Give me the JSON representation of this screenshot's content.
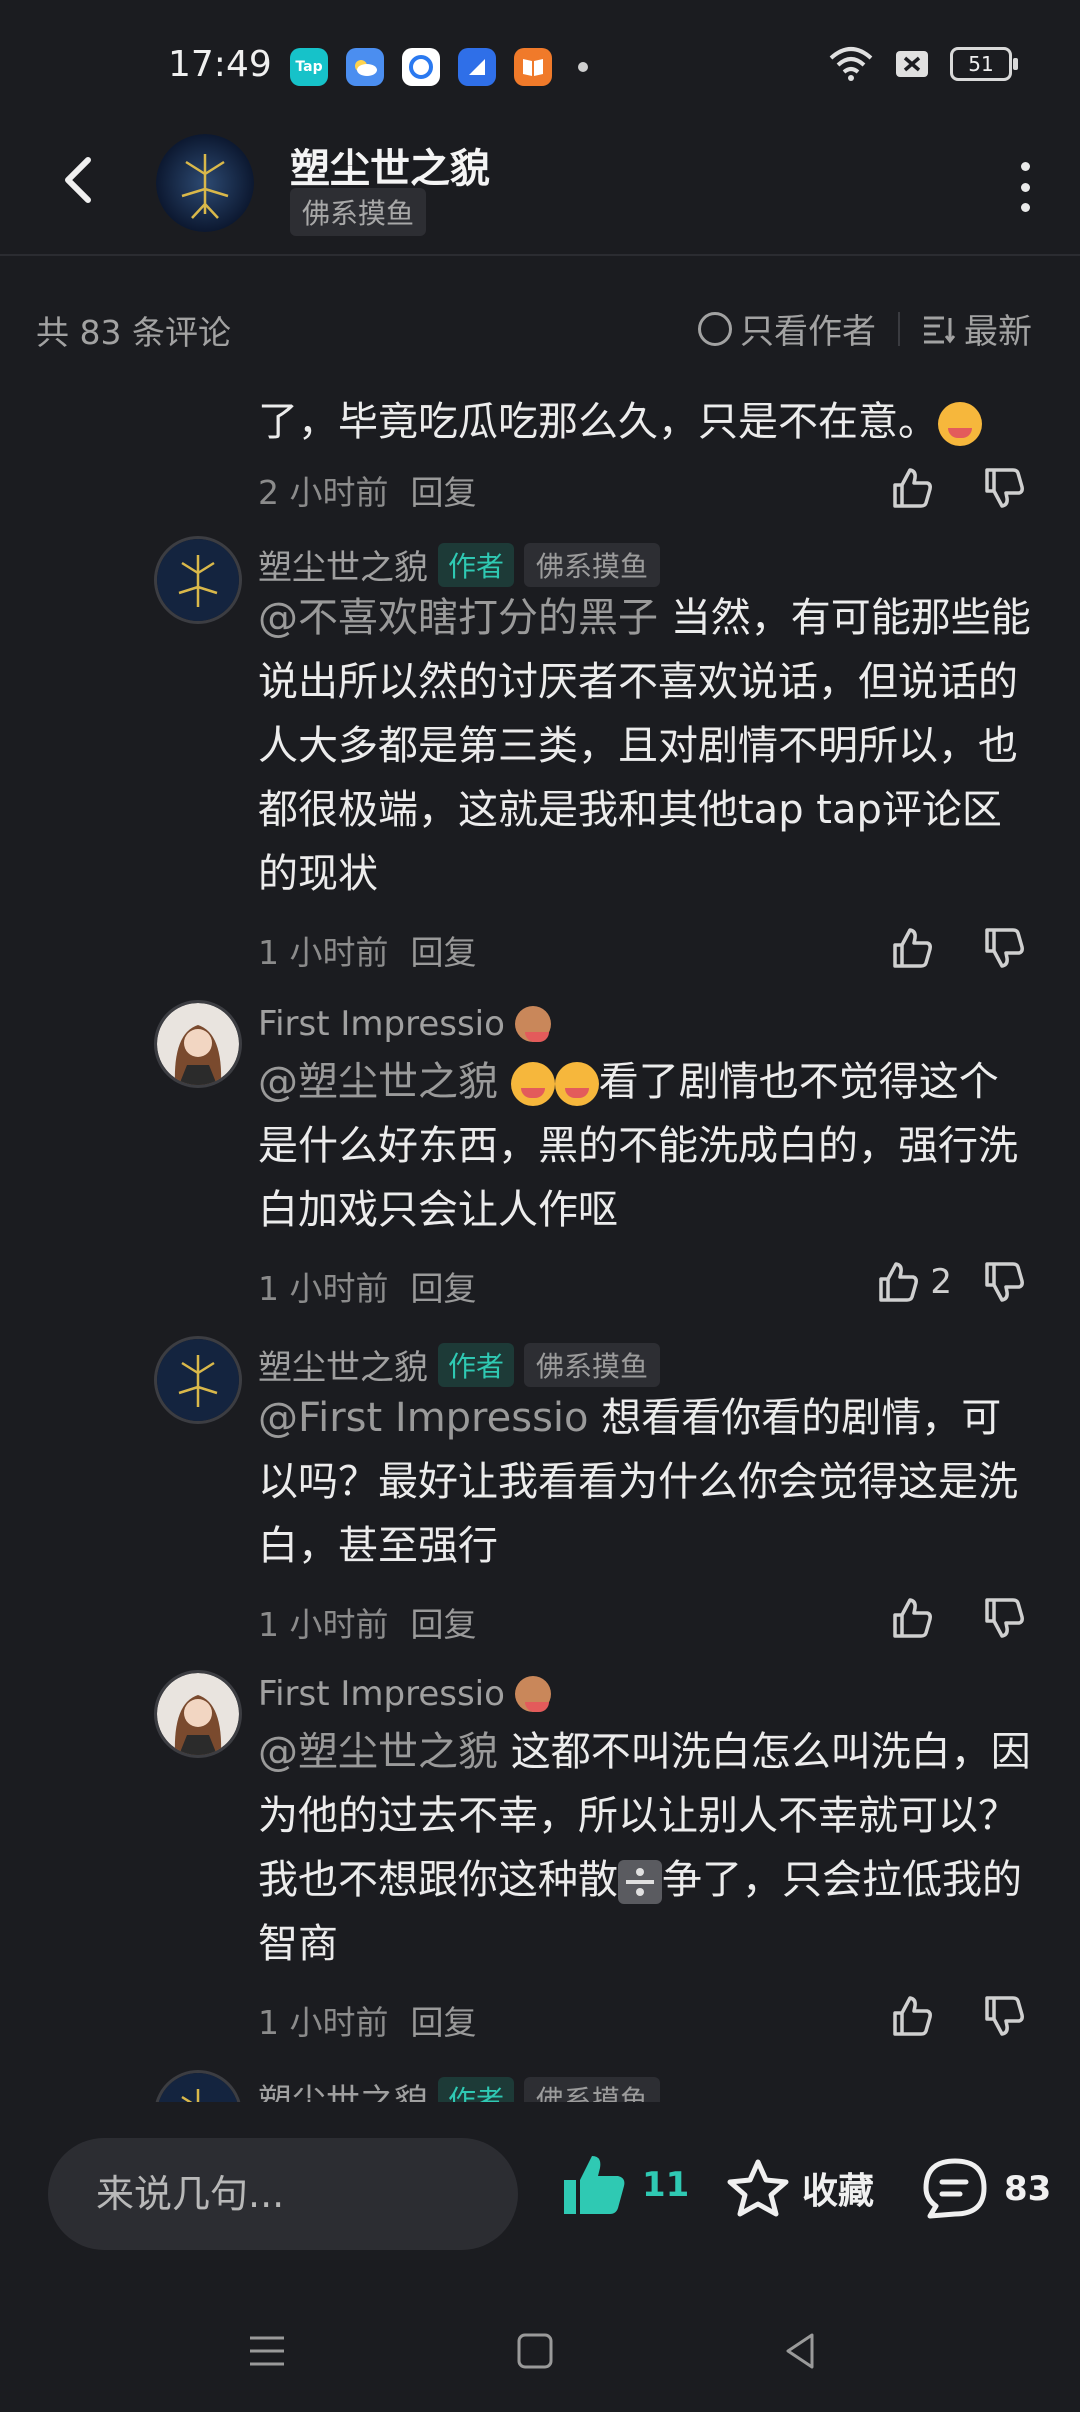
{
  "status_bar": {
    "time": "17:49",
    "battery": "51",
    "app_icons": [
      "taptap-icon",
      "weather-icon",
      "browser-icon",
      "app-icon",
      "books-icon"
    ]
  },
  "header": {
    "title": "塑尘世之貌",
    "tag": "佛系摸鱼"
  },
  "comment_bar": {
    "count_text": "共 83 条评论",
    "only_author": "只看作者",
    "sort": "最新"
  },
  "comments": [
    {
      "text": "了，毕竟吃瓜吃那么久，只是不在意。",
      "time": "2 小时前",
      "reply": "回复",
      "likes": ""
    },
    {
      "name": "塑尘世之貌",
      "author_tag": "作者",
      "group_tag": "佛系摸鱼",
      "mention": "@不喜欢瞎打分的黑子",
      "text": "当然，有可能那些能说出所以然的讨厌者不喜欢说话，但说话的人大多都是第三类，且对剧情不明所以，也都很极端，这就是我和其他tap tap评论区的现状",
      "time": "1 小时前",
      "reply": "回复",
      "likes": ""
    },
    {
      "name": "First Impressio",
      "mention": "@塑尘世之貌",
      "text": "看了剧情也不觉得这个是什么好东西，黑的不能洗成白的，强行洗白加戏只会让人作呕",
      "time": "1 小时前",
      "reply": "回复",
      "likes": "2"
    },
    {
      "name": "塑尘世之貌",
      "author_tag": "作者",
      "group_tag": "佛系摸鱼",
      "mention": "@First Impressio",
      "text": "想看看你看的剧情，可以吗？最好让我看看为什么你会觉得这是洗白，甚至强行",
      "time": "1 小时前",
      "reply": "回复",
      "likes": ""
    },
    {
      "name": "First Impressio",
      "mention": "@塑尘世之貌",
      "text_a": "这都不叫洗白怎么叫洗白，因为他的过去不幸，所以让别人不幸就可以？我也不想跟你这种散",
      "text_b": "争了，只会拉低我的智商",
      "time": "1 小时前",
      "reply": "回复",
      "likes": ""
    },
    {
      "name": "塑尘世之貌",
      "author_tag": "作者",
      "group_tag": "佛系摸鱼"
    }
  ],
  "bottom_bar": {
    "input_placeholder": "来说几句...",
    "like_count": "11",
    "favorite_label": "收藏",
    "comment_count": "83"
  },
  "colors": {
    "background": "#1b1c20",
    "accent": "#2fc9b3"
  }
}
